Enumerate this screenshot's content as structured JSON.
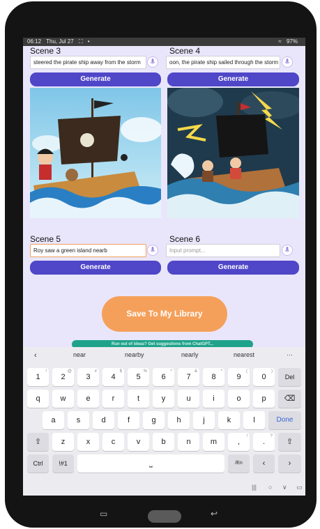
{
  "status": {
    "time": "06:12",
    "date": "Thu, Jul 27",
    "battery": "97%"
  },
  "scenes": [
    {
      "label": "Scene 3",
      "prompt": "steered the pirate ship away from the storm",
      "placeholder": "",
      "button": "Generate"
    },
    {
      "label": "Scene 4",
      "prompt": "oon, the pirate ship sailed through the storm",
      "placeholder": "",
      "button": "Generate"
    },
    {
      "label": "Scene 5",
      "prompt": "Roy saw a green island nearb",
      "placeholder": "",
      "button": "Generate"
    },
    {
      "label": "Scene 6",
      "prompt": "",
      "placeholder": "Input prompt...",
      "button": "Generate"
    }
  ],
  "save_button": "Save To My Library",
  "tip_text": "Run out of ideas? Get suggestions from ChatGPT...",
  "keyboard": {
    "suggestions": [
      "near",
      "nearby",
      "nearly",
      "nearest"
    ],
    "row1": [
      {
        "k": "1",
        "s": "!"
      },
      {
        "k": "2",
        "s": "@"
      },
      {
        "k": "3",
        "s": "#"
      },
      {
        "k": "4",
        "s": "$"
      },
      {
        "k": "5",
        "s": "%"
      },
      {
        "k": "6",
        "s": "^"
      },
      {
        "k": "7",
        "s": "&"
      },
      {
        "k": "8",
        "s": "*"
      },
      {
        "k": "9",
        "s": "("
      },
      {
        "k": "0",
        "s": ")"
      }
    ],
    "row2": [
      "q",
      "w",
      "e",
      "r",
      "t",
      "y",
      "u",
      "i",
      "o",
      "p"
    ],
    "row3": [
      "a",
      "s",
      "d",
      "f",
      "g",
      "h",
      "j",
      "k",
      "l"
    ],
    "row4": [
      "z",
      "x",
      "c",
      "v",
      "b",
      "n",
      "m",
      ",",
      "."
    ],
    "row4_subs": {
      "comma": "!",
      "period": "?"
    },
    "del": "Del",
    "done": "Done",
    "ctrl": "Ctrl",
    "symbols": "!#1",
    "lang": "/En"
  },
  "colors": {
    "generate": "#4f46c8",
    "save": "#f5a05a",
    "background": "#e9e6fb",
    "tip": "#1ea38a"
  }
}
